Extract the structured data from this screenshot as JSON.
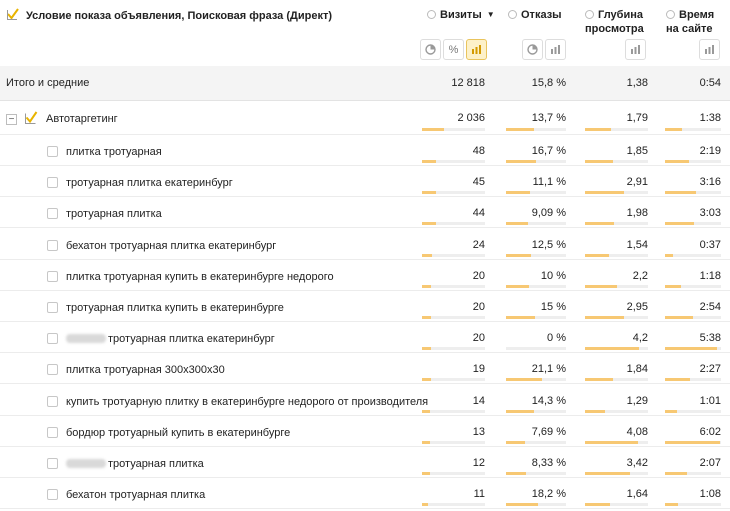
{
  "header": {
    "title": "Условие показа объявления, Поисковая фраза (Директ)",
    "columns": [
      {
        "line1": "Визиты",
        "line2": "",
        "sort": "▼"
      },
      {
        "line1": "Отказы",
        "line2": ""
      },
      {
        "line1": "Глубина",
        "line2": "просмотра"
      },
      {
        "line1": "Время",
        "line2": "на сайте"
      }
    ],
    "view_buttons": [
      {
        "icon": "pie-chart-icon",
        "active": false
      },
      {
        "icon": "percent-icon",
        "label": "%",
        "active": false
      },
      {
        "icon": "bar-chart-icon",
        "active": true
      }
    ]
  },
  "total": {
    "label": "Итого и средние",
    "visits": "12 818",
    "bounce": "15,8 %",
    "depth": "1,38",
    "time": "0:54"
  },
  "group": {
    "label": "Автотаргетинг",
    "expander": "−",
    "checked": true,
    "visits": "2 036",
    "bounce": "13,7 %",
    "depth": "1,79",
    "time": "1:38",
    "bars": {
      "visits": 0.35,
      "bounce": 0.46,
      "depth": 0.42,
      "time": 0.3
    }
  },
  "rows": [
    {
      "label": "плитка тротуарная",
      "blurred_prefix": false,
      "visits": "48",
      "bounce": "16,7 %",
      "depth": "1,85",
      "time": "2:19",
      "bars": {
        "visits": 0.22,
        "bounce": 0.5,
        "depth": 0.44,
        "time": 0.42
      }
    },
    {
      "label": "тротуарная плитка екатеринбург",
      "blurred_prefix": false,
      "visits": "45",
      "bounce": "11,1 %",
      "depth": "2,91",
      "time": "3:16",
      "bars": {
        "visits": 0.22,
        "bounce": 0.4,
        "depth": 0.62,
        "time": 0.55
      }
    },
    {
      "label": "тротуарная плитка",
      "blurred_prefix": false,
      "visits": "44",
      "bounce": "9,09 %",
      "depth": "1,98",
      "time": "3:03",
      "bars": {
        "visits": 0.22,
        "bounce": 0.36,
        "depth": 0.46,
        "time": 0.52
      }
    },
    {
      "label": "бехатон тротуарная плитка екатеринбург",
      "blurred_prefix": false,
      "visits": "24",
      "bounce": "12,5 %",
      "depth": "1,54",
      "time": "0:37",
      "bars": {
        "visits": 0.16,
        "bounce": 0.42,
        "depth": 0.38,
        "time": 0.14
      }
    },
    {
      "label": "плитка тротуарная купить в екатеринбурге недорого",
      "blurred_prefix": false,
      "visits": "20",
      "bounce": "10 %",
      "depth": "2,2",
      "time": "1:18",
      "bars": {
        "visits": 0.14,
        "bounce": 0.38,
        "depth": 0.5,
        "time": 0.28
      }
    },
    {
      "label": "тротуарная плитка купить в екатеринбурге",
      "blurred_prefix": false,
      "visits": "20",
      "bounce": "15 %",
      "depth": "2,95",
      "time": "2:54",
      "bars": {
        "visits": 0.14,
        "bounce": 0.48,
        "depth": 0.62,
        "time": 0.5
      }
    },
    {
      "label": "тротуарная плитка екатеринбург",
      "blurred_prefix": true,
      "visits": "20",
      "bounce": "0 %",
      "depth": "4,2",
      "time": "5:38",
      "bars": {
        "visits": 0.14,
        "bounce": 0.0,
        "depth": 0.86,
        "time": 0.92
      }
    },
    {
      "label": "плитка тротуарная 300х300х30",
      "blurred_prefix": false,
      "visits": "19",
      "bounce": "21,1 %",
      "depth": "1,84",
      "time": "2:27",
      "bars": {
        "visits": 0.14,
        "bounce": 0.6,
        "depth": 0.44,
        "time": 0.44
      }
    },
    {
      "label": "купить тротуарную плитку в екатеринбурге недорого от производителя",
      "blurred_prefix": false,
      "visits": "14",
      "bounce": "14,3 %",
      "depth": "1,29",
      "time": "1:01",
      "bars": {
        "visits": 0.12,
        "bounce": 0.46,
        "depth": 0.32,
        "time": 0.22
      }
    },
    {
      "label": "бордюр тротуарный купить в екатеринбурге",
      "blurred_prefix": false,
      "visits": "13",
      "bounce": "7,69 %",
      "depth": "4,08",
      "time": "6:02",
      "bars": {
        "visits": 0.12,
        "bounce": 0.32,
        "depth": 0.84,
        "time": 0.98
      }
    },
    {
      "label": "тротуарная плитка",
      "blurred_prefix": true,
      "visits": "12",
      "bounce": "8,33 %",
      "depth": "3,42",
      "time": "2:07",
      "bars": {
        "visits": 0.12,
        "bounce": 0.34,
        "depth": 0.72,
        "time": 0.4
      }
    },
    {
      "label": "бехатон тротуарная плитка",
      "blurred_prefix": false,
      "visits": "11",
      "bounce": "18,2 %",
      "depth": "1,64",
      "time": "1:08",
      "bars": {
        "visits": 0.1,
        "bounce": 0.54,
        "depth": 0.4,
        "time": 0.24
      }
    }
  ],
  "colors": {
    "bar_fill": "#f7c873",
    "bar_track": "#eeeeee",
    "total_bg": "#f4f4f4",
    "active_button": "#fdf1c9",
    "check": "#e8b400"
  }
}
